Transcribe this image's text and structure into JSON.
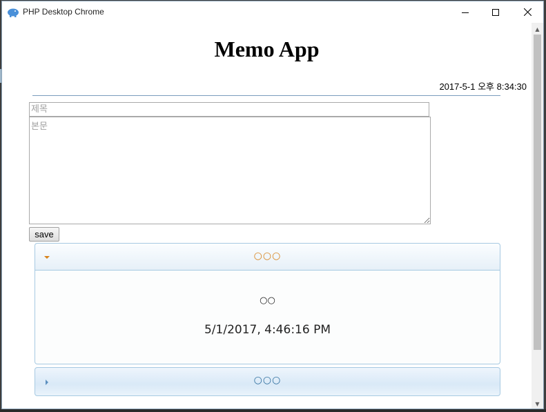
{
  "window": {
    "title": "PHP Desktop Chrome",
    "icon": "php-elephant-icon",
    "controls": [
      "minimize",
      "maximize",
      "close"
    ]
  },
  "page": {
    "title": "Memo App",
    "datetime": "2017-5-1 오후 8:34:30"
  },
  "form": {
    "title_placeholder": "제목",
    "title_value": "",
    "body_placeholder": "본문",
    "body_value": "",
    "save_label": "save"
  },
  "memos": [
    {
      "title": "○○○",
      "body": "○○",
      "date": "5/1/2017, 4:46:16 PM",
      "expanded": true
    },
    {
      "title": "○○○",
      "expanded": false
    }
  ],
  "colors": {
    "accent_open": "#d8831b",
    "accent_closed": "#2e6e9e",
    "accordion_border": "#a6c9e2"
  }
}
